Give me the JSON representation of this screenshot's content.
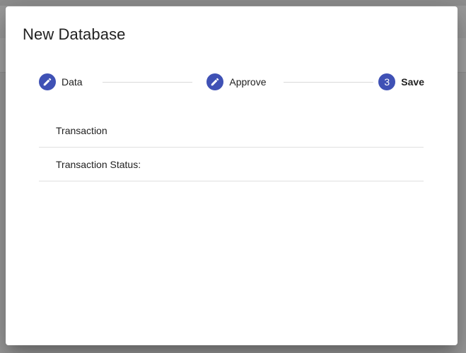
{
  "dialog": {
    "title": "New Database"
  },
  "stepper": {
    "steps": [
      {
        "label": "Data",
        "icon": "pencil-icon",
        "state": "edited"
      },
      {
        "label": "Approve",
        "icon": "pencil-icon",
        "state": "edited"
      },
      {
        "label": "Save",
        "number": "3",
        "state": "active"
      }
    ]
  },
  "rows": [
    {
      "label": "Transaction"
    },
    {
      "label": "Transaction Status:"
    }
  ],
  "colors": {
    "accent": "#3f51b5",
    "divider": "#e0e0e0",
    "text": "#212121"
  }
}
